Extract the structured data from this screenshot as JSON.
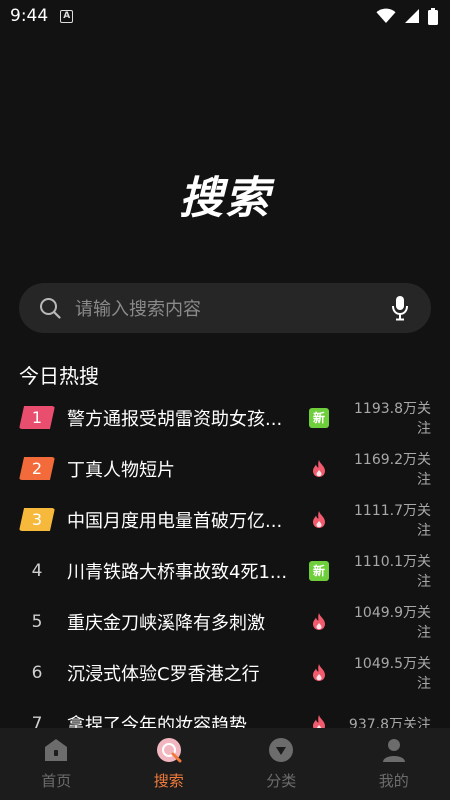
{
  "status": {
    "time": "9:44",
    "notif": "A"
  },
  "hero": {
    "title": "搜索"
  },
  "search": {
    "placeholder": "请输入搜索内容"
  },
  "section": {
    "title": "今日热搜"
  },
  "hot": [
    {
      "rank": "1",
      "title": "警方通报受胡雷资助女孩...",
      "badge": "新",
      "badge_type": "new",
      "follow": "1193.8万关注",
      "rank_color": "#e94e6e"
    },
    {
      "rank": "2",
      "title": "丁真人物短片",
      "badge": "fire",
      "badge_type": "fire",
      "follow": "1169.2万关注",
      "rank_color": "#f36b3a"
    },
    {
      "rank": "3",
      "title": "中国月度用电量首破万亿...",
      "badge": "fire",
      "badge_type": "fire",
      "follow": "1111.7万关注",
      "rank_color": "#f6b93b"
    },
    {
      "rank": "4",
      "title": "川青铁路大桥事故致4死1...",
      "badge": "新",
      "badge_type": "new",
      "follow": "1110.1万关注",
      "rank_color": ""
    },
    {
      "rank": "5",
      "title": "重庆金刀峡溪降有多刺激",
      "badge": "fire",
      "badge_type": "fire",
      "follow": "1049.9万关注",
      "rank_color": ""
    },
    {
      "rank": "6",
      "title": "沉浸式体验C罗香港之行",
      "badge": "fire",
      "badge_type": "fire",
      "follow": "1049.5万关注",
      "rank_color": ""
    },
    {
      "rank": "7",
      "title": "拿捏了今年的妆容趋势",
      "badge": "fire",
      "badge_type": "fire",
      "follow": "937.8万关注",
      "rank_color": ""
    }
  ],
  "tabs": [
    {
      "label": "首页",
      "icon": "home-icon",
      "active": false
    },
    {
      "label": "搜索",
      "icon": "search-tab-icon",
      "active": true
    },
    {
      "label": "分类",
      "icon": "category-icon",
      "active": false
    },
    {
      "label": "我的",
      "icon": "profile-icon",
      "active": false
    }
  ],
  "colors": {
    "accent": "#f07a3a",
    "fire": "#f25a6e",
    "new_badge": "#6fce3c",
    "background": "#121212"
  }
}
